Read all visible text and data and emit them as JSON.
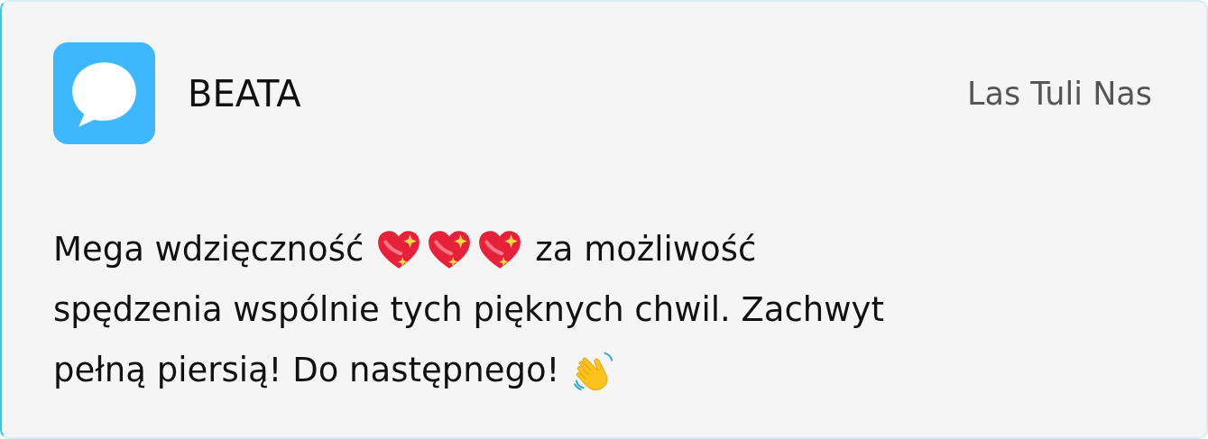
{
  "card": {
    "app": {
      "kind": "chat"
    },
    "author": "BEATA",
    "source": "Las Tuli Nas",
    "message_lines": [
      [
        {
          "kind": "text",
          "text": "Mega wdzięczność"
        },
        {
          "kind": "sparkling-heart"
        },
        {
          "kind": "sparkling-heart"
        },
        {
          "kind": "sparkling-heart"
        },
        {
          "kind": "text",
          "text": "za możliwość"
        }
      ],
      [
        {
          "kind": "text",
          "text": "spędzenia wspólnie tych pięknych chwil. Zachwyt"
        }
      ],
      [
        {
          "kind": "text",
          "text": "pełną piersią! Do następnego!"
        },
        {
          "kind": "waving-hand"
        }
      ]
    ]
  }
}
